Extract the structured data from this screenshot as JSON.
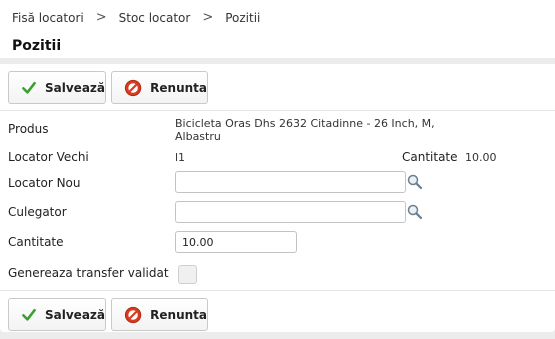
{
  "breadcrumb": {
    "items": [
      "Fisă locatori",
      "Stoc locator",
      "Pozitii"
    ],
    "separator": ">"
  },
  "page": {
    "title": "Pozitii"
  },
  "toolbar": {
    "save_label": "Salvează",
    "cancel_label": "Renunta"
  },
  "form": {
    "produs": {
      "label": "Produs",
      "value_line1": "Bicicleta Oras Dhs 2632 Citadinne - 26 Inch, M,",
      "value_line2": "Albastru"
    },
    "locator_vechi": {
      "label": "Locator Vechi",
      "value": "l1",
      "qty_label": "Cantitate",
      "qty_value": "10.00"
    },
    "locator_nou": {
      "label": "Locator Nou",
      "value": "",
      "icon": "search-icon"
    },
    "culegator": {
      "label": "Culegator",
      "value": "",
      "icon": "search-icon"
    },
    "cantitate": {
      "label": "Cantitate",
      "value": "10.00"
    },
    "genereaza": {
      "label": "Genereaza transfer validat",
      "checked": false
    }
  },
  "colors": {
    "save_check": "#3aa02e",
    "cancel_icon": "#d83a1f",
    "background": "#ececec"
  }
}
